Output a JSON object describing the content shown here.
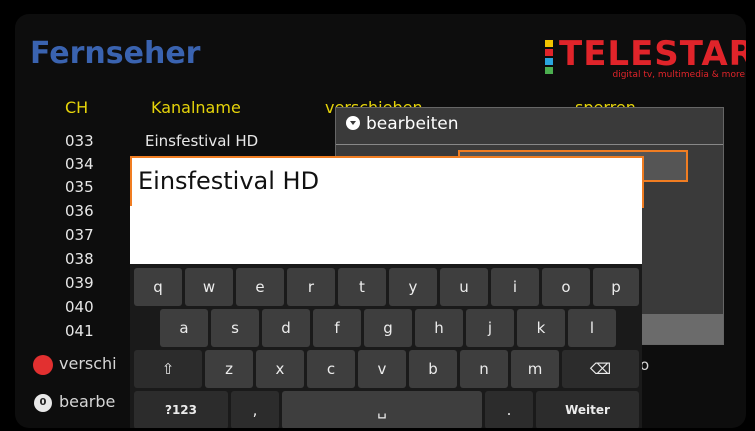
{
  "screen": {
    "title": "Fernseher",
    "logo": {
      "brand": "TELESTAR",
      "tagline": "digital tv, multimedia & more",
      "bar_colors": [
        "#f4c400",
        "#e0242a",
        "#2aa6df",
        "#4caf50"
      ]
    }
  },
  "table": {
    "headers": [
      "CH",
      "Kanalname",
      "verschieben",
      "sperren"
    ],
    "rows": [
      {
        "ch": "033",
        "name": "Einsfestival HD"
      },
      {
        "ch": "034",
        "name": ""
      },
      {
        "ch": "035",
        "name": ""
      },
      {
        "ch": "036",
        "name": ""
      },
      {
        "ch": "037",
        "name": ""
      },
      {
        "ch": "038",
        "name": ""
      },
      {
        "ch": "039",
        "name": ""
      },
      {
        "ch": "040",
        "name": ""
      },
      {
        "ch": "041",
        "name": ""
      }
    ]
  },
  "legend": {
    "red_label": "verschi",
    "zero_label": "bearbe",
    "zero_badge": "0",
    "right_fragment": "o"
  },
  "dialog": {
    "title": "bearbeiten"
  },
  "input": {
    "value": "Einsfestival HD"
  },
  "keyboard": {
    "row1": [
      "q",
      "w",
      "e",
      "r",
      "t",
      "y",
      "u",
      "i",
      "o",
      "p"
    ],
    "row2": [
      "a",
      "s",
      "d",
      "f",
      "g",
      "h",
      "j",
      "k",
      "l"
    ],
    "row3": [
      "z",
      "x",
      "c",
      "v",
      "b",
      "n",
      "m"
    ],
    "shift": "⇧",
    "backspace": "⌫",
    "symbols": "?123",
    "comma": ",",
    "space": "␣",
    "period": ".",
    "done": "Weiter"
  },
  "colors": {
    "accent": "#f07d22",
    "title": "#3a63b0",
    "header": "#e6d40a",
    "brand": "#e0242a"
  }
}
